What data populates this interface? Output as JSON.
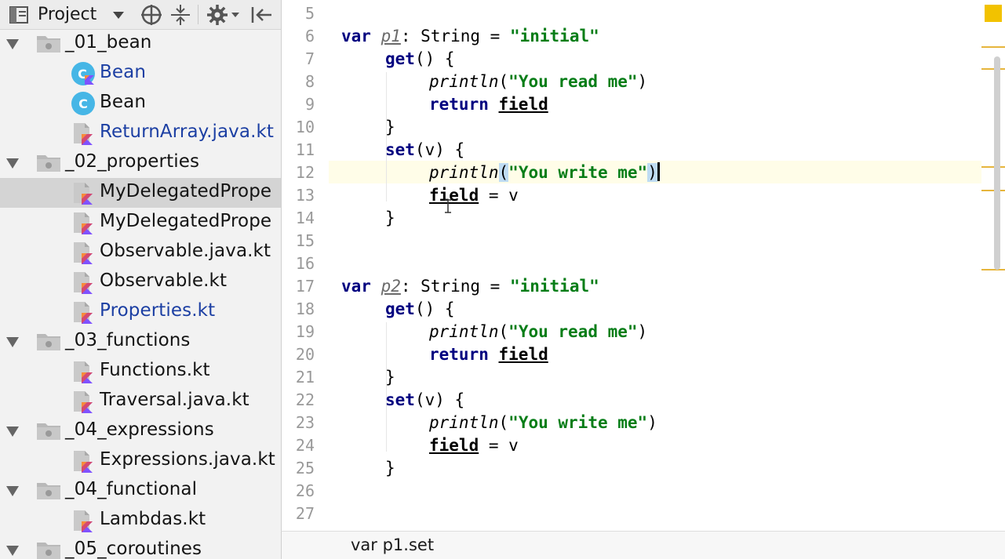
{
  "project_panel": {
    "title": "Project",
    "tree": [
      {
        "kind": "folder",
        "label": "_01_bean",
        "color": "normal"
      },
      {
        "kind": "class-kotlin",
        "label": "Bean",
        "color": "blue"
      },
      {
        "kind": "class",
        "label": "Bean",
        "color": "normal"
      },
      {
        "kind": "kotlin-file",
        "label": "ReturnArray.java.kt",
        "color": "blue"
      },
      {
        "kind": "folder",
        "label": "_02_properties",
        "color": "normal"
      },
      {
        "kind": "kotlin-file",
        "label": "MyDelegatedPrope",
        "color": "normal",
        "selected": true
      },
      {
        "kind": "kotlin-file",
        "label": "MyDelegatedPrope",
        "color": "normal"
      },
      {
        "kind": "kotlin-file",
        "label": "Observable.java.kt",
        "color": "normal"
      },
      {
        "kind": "kotlin-file",
        "label": "Observable.kt",
        "color": "normal"
      },
      {
        "kind": "kotlin-file",
        "label": "Properties.kt",
        "color": "blue"
      },
      {
        "kind": "folder",
        "label": "_03_functions",
        "color": "normal"
      },
      {
        "kind": "kotlin-file",
        "label": "Functions.kt",
        "color": "normal"
      },
      {
        "kind": "kotlin-file",
        "label": "Traversal.java.kt",
        "color": "normal"
      },
      {
        "kind": "folder",
        "label": "_04_expressions",
        "color": "normal"
      },
      {
        "kind": "kotlin-file",
        "label": "Expressions.java.kt",
        "color": "normal"
      },
      {
        "kind": "folder",
        "label": "_04_functional",
        "color": "normal"
      },
      {
        "kind": "kotlin-file",
        "label": "Lambdas.kt",
        "color": "normal"
      },
      {
        "kind": "folder",
        "label": "_05_coroutines",
        "color": "normal"
      }
    ]
  },
  "editor": {
    "line_numbers": [
      "5",
      "6",
      "7",
      "8",
      "9",
      "10",
      "11",
      "12",
      "13",
      "14",
      "15",
      "16",
      "17",
      "18",
      "19",
      "20",
      "21",
      "22",
      "23",
      "24",
      "25",
      "26",
      "27"
    ],
    "tokens": {
      "var_kw": "var",
      "p1": "p1",
      "p2": "p2",
      "colon_type": ": String = ",
      "initial": "\"initial\"",
      "get": "get",
      "get_rest": "() {",
      "println": "println",
      "open_paren": "(",
      "close_paren": ")",
      "read_str": "\"You read me\"",
      "write_str": "\"You write me\"",
      "return_kw": "return",
      "field": "field",
      "close_brace": "}",
      "set": "set",
      "set_rest": "(v) {",
      "assign_v": " = v"
    }
  },
  "breadcrumb": {
    "text": "var p1.set"
  },
  "colors": {
    "keyword": "#000080",
    "string": "#067d17",
    "caret_line": "#fffde8",
    "selection": "#d4d4d4",
    "marker": "#e6b53c"
  }
}
